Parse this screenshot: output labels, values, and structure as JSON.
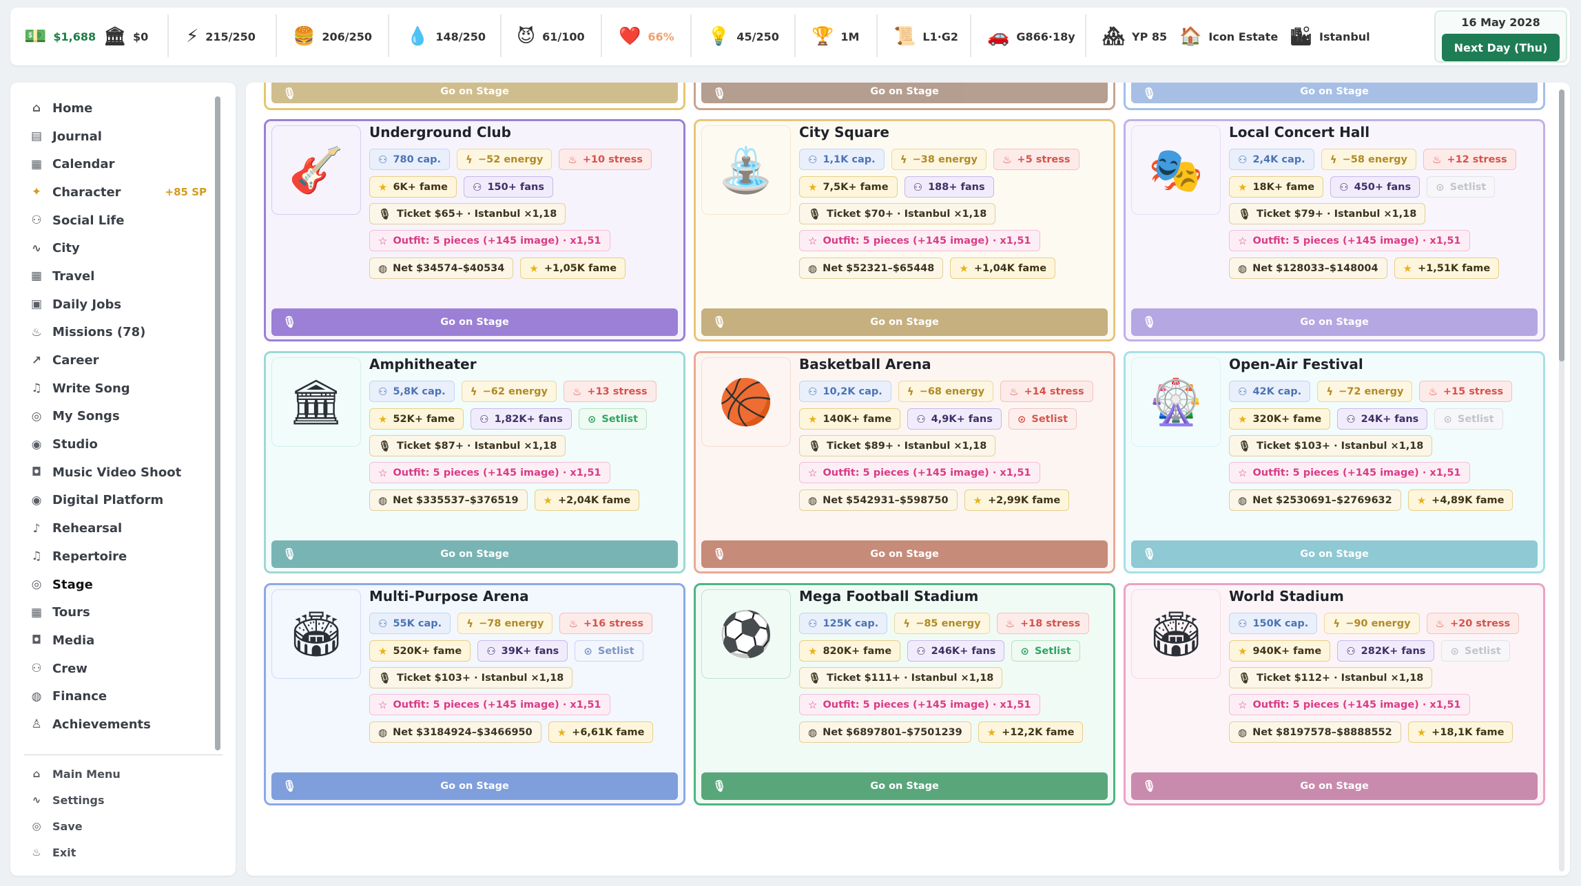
{
  "stats": {
    "money": "$1,688",
    "bank": "$0",
    "energy": "215/250",
    "food": "206/250",
    "water": "148/250",
    "mood": "61/100",
    "health": "66%",
    "ideas": "45/250",
    "fame": "1M",
    "level": "L1·G2",
    "vehicle": "G866·18y",
    "yp": "YP 85",
    "home": "Icon Estate",
    "city": "Istanbul"
  },
  "date": {
    "label": "16 May 2028",
    "next_label": "Next Day (Thu)"
  },
  "nav": [
    {
      "label": "Home",
      "icon": "home-icon"
    },
    {
      "label": "Journal",
      "icon": "journal-icon"
    },
    {
      "label": "Calendar",
      "icon": "calendar-icon"
    },
    {
      "label": "Character",
      "icon": "character-icon",
      "badge": "+85 SP"
    },
    {
      "label": "Social Life",
      "icon": "people-icon"
    },
    {
      "label": "City",
      "icon": "pulse-icon"
    },
    {
      "label": "Travel",
      "icon": "calendar-icon"
    },
    {
      "label": "Daily Jobs",
      "icon": "briefcase-icon"
    },
    {
      "label": "Missions (78)",
      "icon": "flame-icon"
    },
    {
      "label": "Career",
      "icon": "trend-icon"
    },
    {
      "label": "Write Song",
      "icon": "music-note-icon"
    },
    {
      "label": "My Songs",
      "icon": "disc-icon"
    },
    {
      "label": "Studio",
      "icon": "broadcast-icon"
    },
    {
      "label": "Music Video Shoot",
      "icon": "camera-icon"
    },
    {
      "label": "Digital Platform",
      "icon": "broadcast-icon"
    },
    {
      "label": "Rehearsal",
      "icon": "mic-icon"
    },
    {
      "label": "Repertoire",
      "icon": "music-note-icon"
    },
    {
      "label": "Stage",
      "icon": "disc-icon"
    },
    {
      "label": "Tours",
      "icon": "calendar-icon"
    },
    {
      "label": "Media",
      "icon": "camera-icon"
    },
    {
      "label": "Crew",
      "icon": "people-icon"
    },
    {
      "label": "Finance",
      "icon": "coins-icon"
    },
    {
      "label": "Achievements",
      "icon": "award-icon"
    }
  ],
  "sub_nav": [
    {
      "label": "Main Menu",
      "icon": "home-icon"
    },
    {
      "label": "Settings",
      "icon": "pulse-icon"
    },
    {
      "label": "Save",
      "icon": "disc-icon"
    },
    {
      "label": "Exit",
      "icon": "flame-icon"
    }
  ],
  "stage_label": "Go on Stage",
  "venues": [
    {
      "name": "Underground Club",
      "cap": "780 cap.",
      "energy": "−52 energy",
      "stress": "+10 stress",
      "fame": "6K+ fame",
      "fans": "150+ fans",
      "setlist": null,
      "setlist_style": null,
      "ticket": "Ticket $65+ · Istanbul ×1,18",
      "outfit": "Outfit: 5 pieces (+145 image) · x1,51",
      "net": "Net $34574–$40534",
      "net_fame": "+1,05K fame",
      "color": "#9a7fd6",
      "bg": "#f6f3fd",
      "btn": "#9b80d6",
      "emoji": "🎸"
    },
    {
      "name": "City Square",
      "cap": "1,1K cap.",
      "energy": "−38 energy",
      "stress": "+5 stress",
      "fame": "7,5K+ fame",
      "fans": "188+ fans",
      "setlist": null,
      "setlist_style": null,
      "ticket": "Ticket $70+ · Istanbul ×1,18",
      "outfit": "Outfit: 5 pieces (+145 image) · x1,51",
      "net": "Net $52321–$65448",
      "net_fame": "+1,04K fame",
      "color": "#e9c47a",
      "bg": "#fdfaf2",
      "btn": "#c6b07f",
      "emoji": "⛲"
    },
    {
      "name": "Local Concert Hall",
      "cap": "2,4K cap.",
      "energy": "−58 energy",
      "stress": "+12 stress",
      "fame": "18K+ fame",
      "fans": "450+ fans",
      "setlist": "Setlist",
      "setlist_style": "faint",
      "ticket": "Ticket $79+ · Istanbul ×1,18",
      "outfit": "Outfit: 5 pieces (+145 image) · x1,51",
      "net": "Net $128033–$148004",
      "net_fame": "+1,51K fame",
      "color": "#c1b0e8",
      "bg": "#f8f5fd",
      "btn": "#b5a7e2",
      "emoji": "🎭"
    },
    {
      "name": "Amphitheater",
      "cap": "5,8K cap.",
      "energy": "−62 energy",
      "stress": "+13 stress",
      "fame": "52K+ fame",
      "fans": "1,82K+ fans",
      "setlist": "Setlist",
      "setlist_style": "green",
      "ticket": "Ticket $87+ · Istanbul ×1,18",
      "outfit": "Outfit: 5 pieces (+145 image) · x1,51",
      "net": "Net $335537–$376519",
      "net_fame": "+2,04K fame",
      "color": "#9ed8d4",
      "bg": "#f1fcfb",
      "btn": "#78b4b4",
      "emoji": "🏛"
    },
    {
      "name": "Basketball Arena",
      "cap": "10,2K cap.",
      "energy": "−68 energy",
      "stress": "+14 stress",
      "fame": "140K+ fame",
      "fans": "4,9K+ fans",
      "setlist": "Setlist",
      "setlist_style": "red",
      "ticket": "Ticket $89+ · Istanbul ×1,18",
      "outfit": "Outfit: 5 pieces (+145 image) · x1,51",
      "net": "Net $542931–$598750",
      "net_fame": "+2,99K fame",
      "color": "#e9a994",
      "bg": "#fdf5f2",
      "btn": "#c78b7a",
      "emoji": "🏀"
    },
    {
      "name": "Open-Air Festival",
      "cap": "42K cap.",
      "energy": "−72 energy",
      "stress": "+15 stress",
      "fame": "320K+ fame",
      "fans": "24K+ fans",
      "setlist": "Setlist",
      "setlist_style": "faint",
      "ticket": "Ticket $103+ · Istanbul ×1,18",
      "outfit": "Outfit: 5 pieces (+145 image) · x1,51",
      "net": "Net $2530691–$2769632",
      "net_fame": "+4,89K fame",
      "color": "#a8e0e6",
      "bg": "#f2fcfd",
      "btn": "#8ec9d4",
      "emoji": "🎡"
    },
    {
      "name": "Multi-Purpose Arena",
      "cap": "55K cap.",
      "energy": "−78 energy",
      "stress": "+16 stress",
      "fame": "520K+ fame",
      "fans": "39K+ fans",
      "setlist": "Setlist",
      "setlist_style": "blue",
      "ticket": "Ticket $103+ · Istanbul ×1,18",
      "outfit": "Outfit: 5 pieces (+145 image) · x1,51",
      "net": "Net $3184924–$3466950",
      "net_fame": "+6,61K fame",
      "color": "#8ba8e8",
      "bg": "#f3f7fe",
      "btn": "#7f9fdc",
      "emoji": "🏟"
    },
    {
      "name": "Mega Football Stadium",
      "cap": "125K cap.",
      "energy": "−85 energy",
      "stress": "+18 stress",
      "fame": "820K+ fame",
      "fans": "246K+ fans",
      "setlist": "Setlist",
      "setlist_style": "green",
      "ticket": "Ticket $111+ · Istanbul ×1,18",
      "outfit": "Outfit: 5 pieces (+145 image) · x1,51",
      "net": "Net $6897801–$7501239",
      "net_fame": "+12,2K fame",
      "color": "#4db581",
      "bg": "#f1fbf5",
      "btn": "#5aa67b",
      "emoji": "⚽"
    },
    {
      "name": "World Stadium",
      "cap": "150K cap.",
      "energy": "−90 energy",
      "stress": "+20 stress",
      "fame": "940K+ fame",
      "fans": "282K+ fans",
      "setlist": "Setlist",
      "setlist_style": "faint",
      "ticket": "Ticket $112+ · Istanbul ×1,18",
      "outfit": "Outfit: 5 pieces (+145 image) · x1,51",
      "net": "Net $8197578–$8888552",
      "net_fame": "+18,1K fame",
      "color": "#eaa2c4",
      "bg": "#fdf4f8",
      "btn": "#c98bad",
      "emoji": "🏟"
    }
  ],
  "partial_colors": [
    "#e6c66a",
    "#c9a48c",
    "#a3bfe8"
  ],
  "partial_btn_colors": [
    "#c8b27a",
    "#a88e7d",
    "#98b4e0"
  ]
}
